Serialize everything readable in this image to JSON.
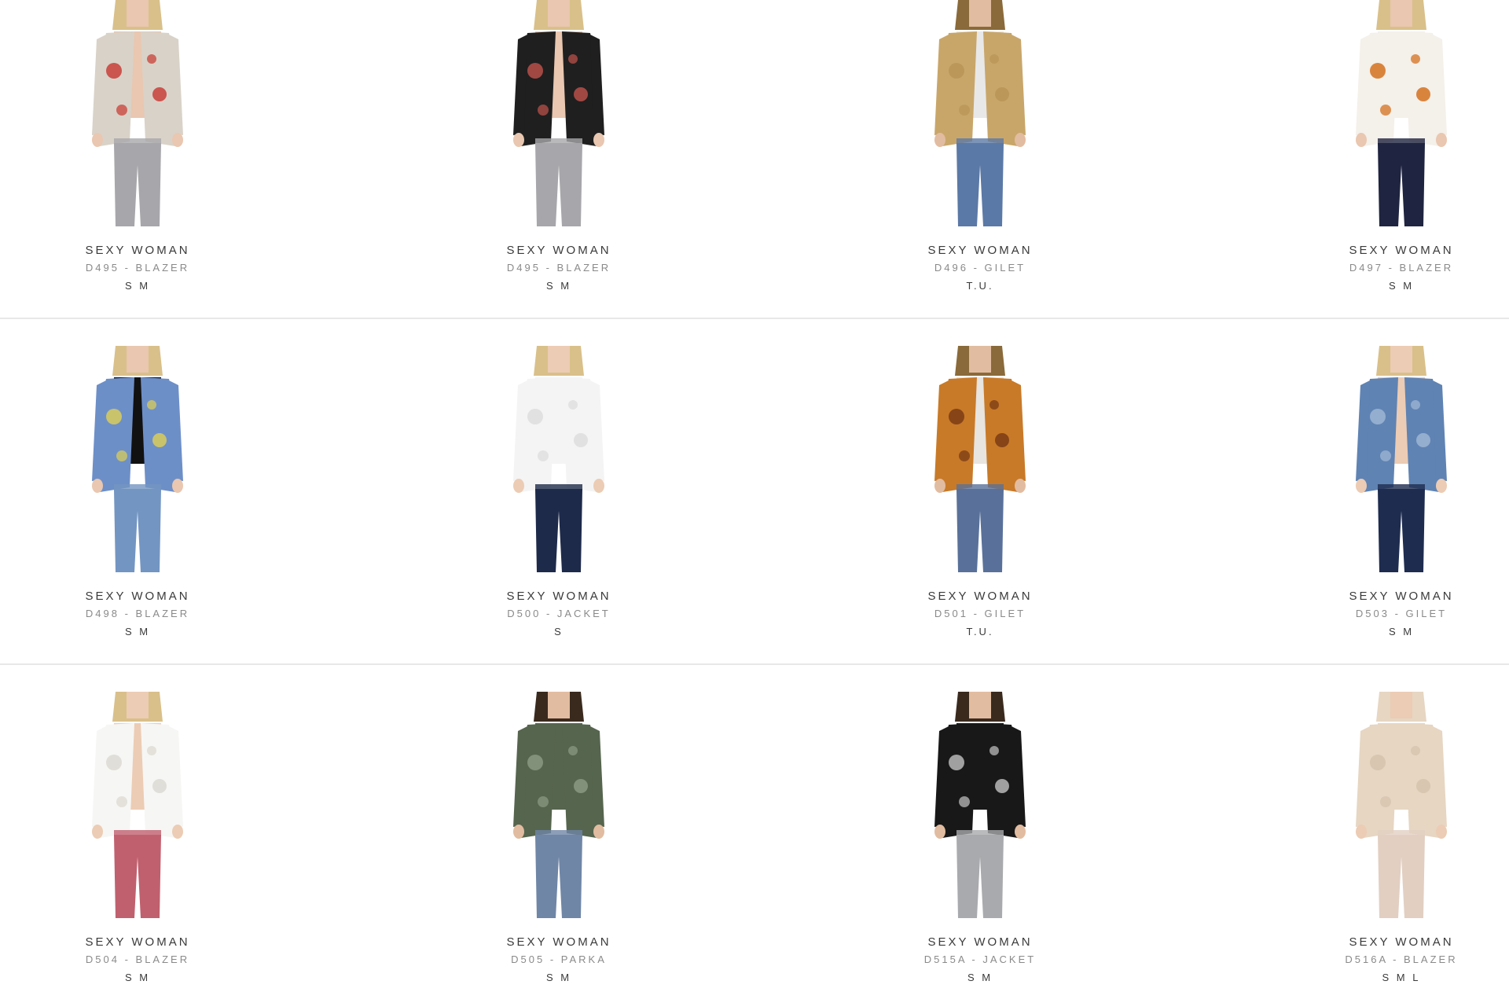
{
  "products": [
    {
      "brand": "SEXY WOMAN",
      "model": "D495 - BLAZER",
      "sizes": "S M",
      "top_color": "#d9d2c8",
      "accent": "#c8403a",
      "pants": "#a7a7ab",
      "skin": "#e9c7b0",
      "hair": "#d9c08a",
      "inner": "#e9c7b0"
    },
    {
      "brand": "SEXY WOMAN",
      "model": "D495 - BLAZER",
      "sizes": "S M",
      "top_color": "#1f1f1f",
      "accent": "#b8504a",
      "pants": "#a7a7ab",
      "skin": "#e9c7b0",
      "hair": "#d9c08a",
      "inner": "#e9c7b0"
    },
    {
      "brand": "SEXY WOMAN",
      "model": "D496 - GILET",
      "sizes": "T.U.",
      "top_color": "#c8a66a",
      "accent": "#b99557",
      "pants": "#5b79a6",
      "skin": "#e2bca0",
      "hair": "#8a6a3a",
      "inner": "#e8e8e8"
    },
    {
      "brand": "SEXY WOMAN",
      "model": "D497 - BLAZER",
      "sizes": "S M",
      "top_color": "#f4f0ea",
      "accent": "#d4711f",
      "pants": "#1f2440",
      "skin": "#e9c7b0",
      "hair": "#d9c08a",
      "inner": "#f4f0ea"
    },
    {
      "brand": "SEXY WOMAN",
      "model": "D498 - BLAZER",
      "sizes": "S M",
      "top_color": "#6d8fc8",
      "accent": "#d9cc5a",
      "pants": "#7395c2",
      "skin": "#e9c7b0",
      "hair": "#d9c08a",
      "inner": "#111111"
    },
    {
      "brand": "SEXY WOMAN",
      "model": "D500 - JACKET",
      "sizes": "S",
      "top_color": "#f4f4f4",
      "accent": "#dddddd",
      "pants": "#1e2a4a",
      "skin": "#ecccb4",
      "hair": "#d9c08a",
      "inner": "#f4f4f4"
    },
    {
      "brand": "SEXY WOMAN",
      "model": "D501 - GILET",
      "sizes": "T.U.",
      "top_color": "#c87a28",
      "accent": "#7a3b14",
      "pants": "#59719a",
      "skin": "#e2bca0",
      "hair": "#8a6a3a",
      "inner": "#e8e4df"
    },
    {
      "brand": "SEXY WOMAN",
      "model": "D503 - GILET",
      "sizes": "S M",
      "top_color": "#5f83b3",
      "accent": "#9eb6d4",
      "pants": "#1e2c4f",
      "skin": "#ecccb4",
      "hair": "#d9c08a",
      "inner": "#ecccb4"
    },
    {
      "brand": "SEXY WOMAN",
      "model": "D504 - BLAZER",
      "sizes": "S M",
      "top_color": "#f6f6f4",
      "accent": "#dcd9d2",
      "pants": "#c0606e",
      "skin": "#ecccb4",
      "hair": "#d9c08a",
      "inner": "#ecccb4"
    },
    {
      "brand": "SEXY WOMAN",
      "model": "D505 - PARKA",
      "sizes": "S M",
      "top_color": "#56654e",
      "accent": "#8a9a82",
      "pants": "#6f86a6",
      "skin": "#e2bca0",
      "hair": "#3a2a1e",
      "inner": "#56654e"
    },
    {
      "brand": "SEXY WOMAN",
      "model": "D515A - JACKET",
      "sizes": "S M",
      "top_color": "#181818",
      "accent": "#b9b9b9",
      "pants": "#a9aaad",
      "skin": "#e2bca0",
      "hair": "#3a2a1e",
      "inner": "#181818"
    },
    {
      "brand": "SEXY WOMAN",
      "model": "D516A - BLAZER",
      "sizes": "S M L",
      "top_color": "#e6d6c2",
      "accent": "#d5c3ad",
      "pants": "#e2cfc2",
      "skin": "#ecccb4",
      "hair": "#e6d6c2",
      "inner": "#e6d6c2"
    }
  ]
}
